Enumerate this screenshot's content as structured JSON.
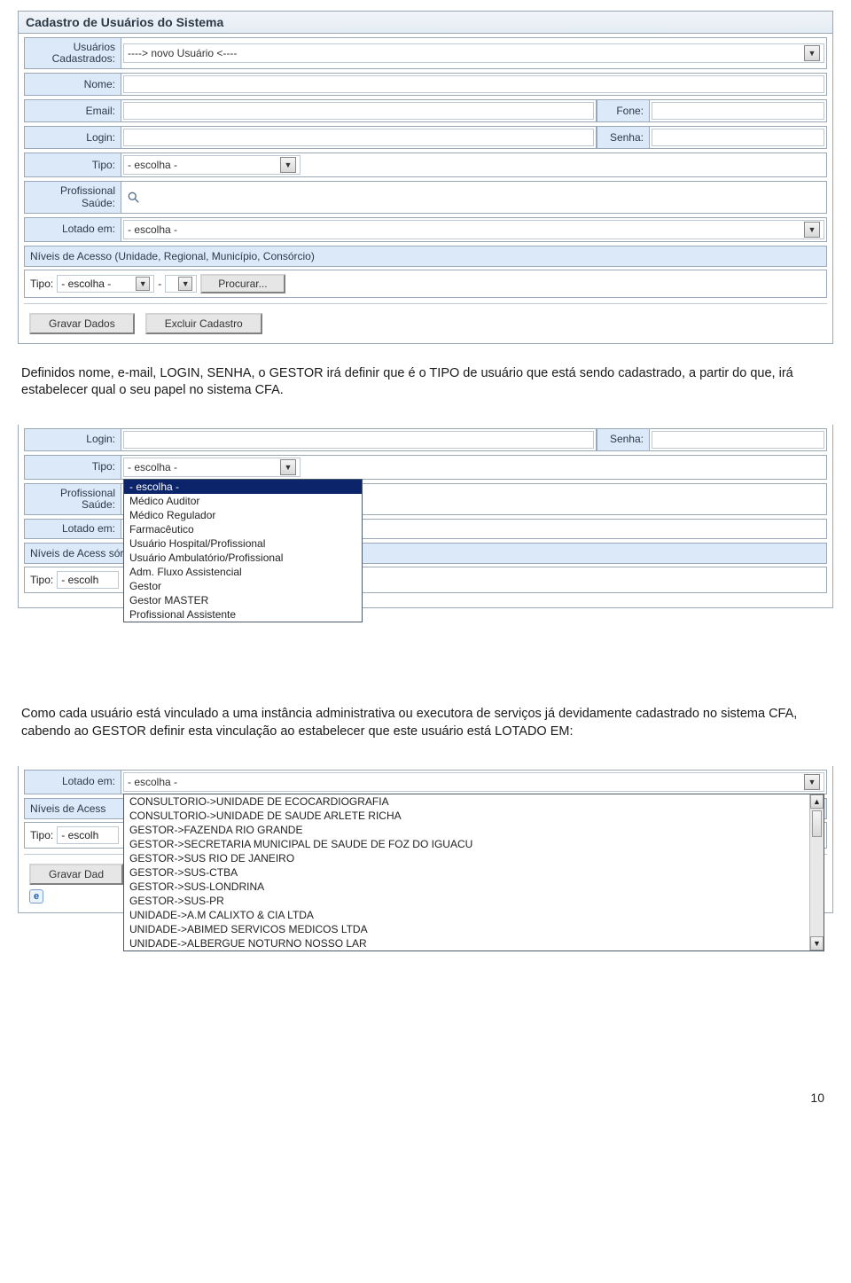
{
  "shot1": {
    "title": "Cadastro de Usuários do Sistema",
    "labels": {
      "usuarios": "Usuários Cadastrados:",
      "nome": "Nome:",
      "email": "Email:",
      "fone": "Fone:",
      "login": "Login:",
      "senha": "Senha:",
      "tipo": "Tipo:",
      "profissional": "Profissional Saúde:",
      "lotado": "Lotado em:"
    },
    "values": {
      "usuarios_selected": "----> novo Usuário <----",
      "tipo_selected": "- escolha -",
      "lotado_selected": "- escolha -"
    },
    "niveis_header": "Níveis de Acesso (Unidade, Regional, Município, Consórcio)",
    "filter": {
      "tipo_label": "Tipo:",
      "tipo_value": "- escolha -",
      "sep": "-",
      "procurar": "Procurar..."
    },
    "buttons": {
      "gravar": "Gravar Dados",
      "excluir": "Excluir Cadastro"
    }
  },
  "para1": "Definidos nome, e-mail, LOGIN, SENHA, o GESTOR irá definir que é o TIPO de usuário que está sendo cadastrado, a partir do que, irá estabelecer qual o seu papel no sistema CFA.",
  "shot2": {
    "labels": {
      "login": "Login:",
      "senha": "Senha:",
      "tipo": "Tipo:",
      "profissional": "Profissional Saúde:",
      "lotado": "Lotado em:"
    },
    "tipo_selected": "- escolha -",
    "tipo_options": [
      "- escolha -",
      "Médico Auditor",
      "Médico Regulador",
      "Farmacêutico",
      "Usuário Hospital/Profissional",
      "Usuário Ambulatório/Profissional",
      "Adm. Fluxo Assistencial",
      "Gestor",
      "Gestor MASTER",
      "Profissional Assistente"
    ],
    "niveis_header_partial": "Níveis de Acess                                                              sórcio)",
    "filter_tipo_label": "Tipo:",
    "filter_tipo_value": "- escolh"
  },
  "para2": "Como cada usuário está vinculado a uma instância administrativa ou executora de serviços já devidamente cadastrado no sistema CFA, cabendo ao GESTOR definir esta vinculação ao estabelecer que este usuário está LOTADO EM:",
  "shot3": {
    "lotado_label": "Lotado em:",
    "lotado_selected": "- escolha -",
    "niveis_header_partial": "Níveis de Acess",
    "filter_tipo_label": "Tipo:",
    "filter_tipo_value": "- escolh",
    "gravar_partial": "Gravar Dad",
    "lotado_options": [
      "CONSULTORIO->UNIDADE DE ECOCARDIOGRAFIA",
      "CONSULTORIO->UNIDADE DE SAUDE ARLETE RICHA",
      "GESTOR->FAZENDA RIO GRANDE",
      "GESTOR->SECRETARIA MUNICIPAL DE SAUDE DE FOZ DO IGUACU",
      "GESTOR->SUS RIO DE JANEIRO",
      "GESTOR->SUS-CTBA",
      "GESTOR->SUS-LONDRINA",
      "GESTOR->SUS-PR",
      "UNIDADE->A.M CALIXTO & CIA LTDA",
      "UNIDADE->ABIMED SERVICOS MEDICOS LTDA",
      "UNIDADE->ALBERGUE NOTURNO NOSSO LAR"
    ]
  },
  "page_number": "10"
}
